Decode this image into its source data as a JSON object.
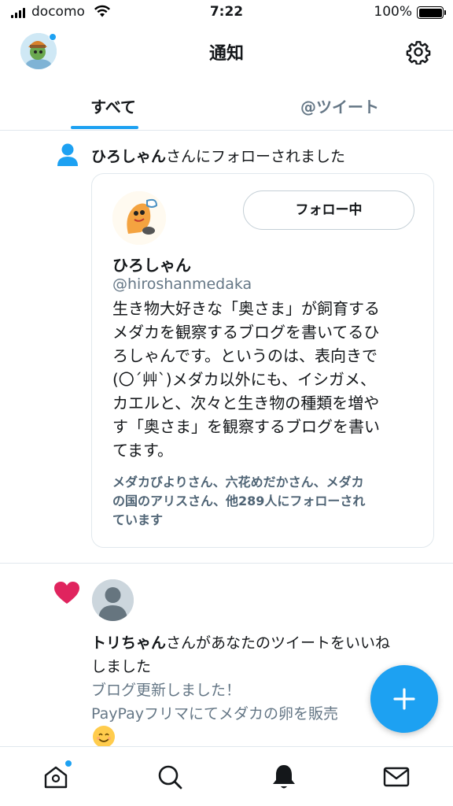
{
  "status_bar": {
    "carrier": "docomo",
    "time": "7:22",
    "battery": "100%"
  },
  "header": {
    "title": "通知"
  },
  "tabs": [
    {
      "label": "すべて",
      "active": true
    },
    {
      "label": "@ツイート",
      "active": false
    }
  ],
  "follow_notification": {
    "user": "ひろしゃん",
    "text": "さんにフォローされました",
    "card": {
      "button_label": "フォロー中",
      "name": "ひろしゃん",
      "handle": "@hiroshanmedaka",
      "bio_lines": [
        "生き物大好きな「奥さま」が飼育する",
        "メダカを観察するブログを書いてるひ",
        "ろしゃんです。というのは、表向きで",
        "(〇´艸`)メダカ以外にも、イシガメ、",
        "カエルと、次々と生き物の種類を増や",
        "す「奥さま」を観察するブログを書い",
        "てます。"
      ],
      "followed_by_lines": [
        "メダカびよりさん、六花めだかさん、メダカ",
        "の国のアリスさん、他289人にフォローされ",
        "ています"
      ]
    }
  },
  "like_notification": {
    "user": "トリちゃん",
    "text_line1": "さんがあなたのツイートをいいね",
    "text_line2": "しました",
    "tweet_lines": [
      "ブログ更新しました！",
      "PayPayフリマにてメダカの卵を販売"
    ],
    "emoji": "smiling-face-icon"
  },
  "fab": {
    "label": "+"
  },
  "colors": {
    "accent": "#1da1f2",
    "heart": "#e0245e",
    "secondary_text": "#657786"
  }
}
